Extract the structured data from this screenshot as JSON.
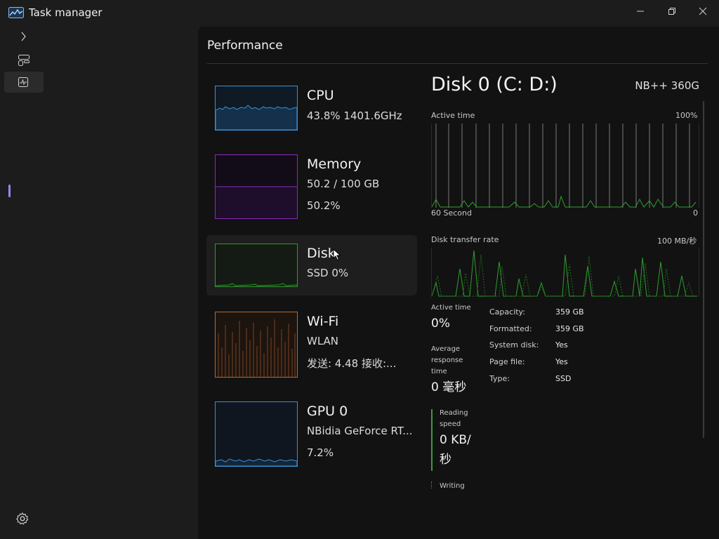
{
  "app": {
    "title": "Task manager"
  },
  "page": {
    "title": "Performance"
  },
  "devices": [
    {
      "name": "CPU",
      "line1": "43.8% 1401.6GHz",
      "line2": "",
      "color": "#3c8fd6"
    },
    {
      "name": "Memory",
      "line1": "50.2 / 100 GB",
      "line2": "50.2%",
      "color": "#8a2ab8"
    },
    {
      "name": "Disk",
      "line1": "SSD 0%",
      "line2": "",
      "color": "#2e9e2e"
    },
    {
      "name": "Wi-Fi",
      "line1": "WLAN",
      "line2": "发送: 4.48 接收:...",
      "color": "#b86a30"
    },
    {
      "name": "GPU 0",
      "line1": "NBidia GeForce RT...",
      "line2": "7.2%",
      "color": "#3c8fd6"
    }
  ],
  "detail": {
    "title": "Disk 0 (C: D:)",
    "model": "NB++ 360G",
    "active_time_graph": {
      "label": "Active time",
      "max_label": "100%",
      "x_label": "60 Second",
      "min_label": "0"
    },
    "transfer_graph": {
      "label": "Disk transfer rate",
      "max_label": "100 MB/秒"
    },
    "stats": {
      "active_time_label": "Active time",
      "active_time_value": "0%",
      "avg_resp_label_1": "Average",
      "avg_resp_label_2": "response",
      "avg_resp_label_3": "time",
      "avg_resp_value": "0 毫秒",
      "read_label_1": "Reading",
      "read_label_2": "speed",
      "read_value_1": "0 KB/",
      "read_value_2": "秒",
      "write_label": "Writing"
    },
    "properties": [
      {
        "label": "Capacity:",
        "value": "359 GB"
      },
      {
        "label": "Formatted:",
        "value": "359 GB"
      },
      {
        "label": "System disk:",
        "value": "Yes"
      },
      {
        "label": "Page file:",
        "value": "Yes"
      },
      {
        "label": "Type:",
        "value": "SSD"
      }
    ]
  },
  "icons": {
    "app": "task-manager-chart-icon",
    "minimize": "minimize-icon",
    "restore": "restore-icon",
    "close": "close-icon",
    "expand": "chevron-right-icon",
    "processes": "processes-icon",
    "performance": "performance-icon",
    "settings": "gear-icon"
  }
}
